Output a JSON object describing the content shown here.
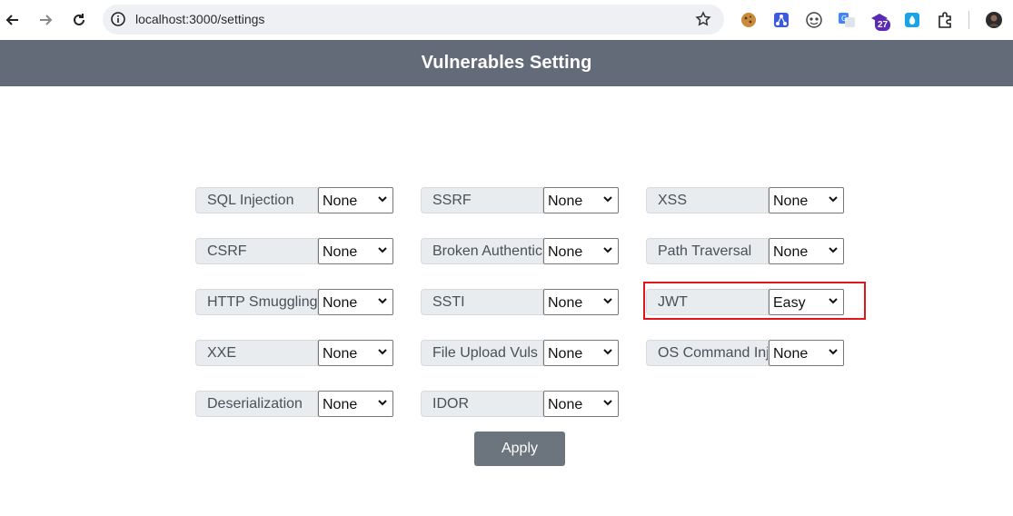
{
  "browser": {
    "url": "localhost:3000/settings",
    "extension_badge": "27"
  },
  "page": {
    "title": "Vulnerables Setting"
  },
  "settings": {
    "sql_injection": {
      "label": "SQL Injection",
      "value": "None"
    },
    "ssrf": {
      "label": "SSRF",
      "value": "None"
    },
    "xss": {
      "label": "XSS",
      "value": "None"
    },
    "csrf": {
      "label": "CSRF",
      "value": "None"
    },
    "broken_auth": {
      "label": "Broken Authentic",
      "value": "None"
    },
    "path_traversal": {
      "label": "Path Traversal",
      "value": "None"
    },
    "http_smuggling": {
      "label": "HTTP Smuggling",
      "value": "None"
    },
    "ssti": {
      "label": "SSTI",
      "value": "None"
    },
    "jwt": {
      "label": "JWT",
      "value": "Easy"
    },
    "xxe": {
      "label": "XXE",
      "value": "None"
    },
    "file_upload": {
      "label": "File Upload Vuls",
      "value": "None"
    },
    "os_command_injection": {
      "label": "OS Command Inje",
      "value": "None"
    },
    "deserialization": {
      "label": "Deserialization",
      "value": "None"
    },
    "idor": {
      "label": "IDOR",
      "value": "None"
    }
  },
  "actions": {
    "apply_label": "Apply"
  },
  "colors": {
    "header_bg": "#636b78",
    "label_bg": "#e9ecef",
    "button_bg": "#6c757d",
    "highlight": "#e3141b"
  }
}
